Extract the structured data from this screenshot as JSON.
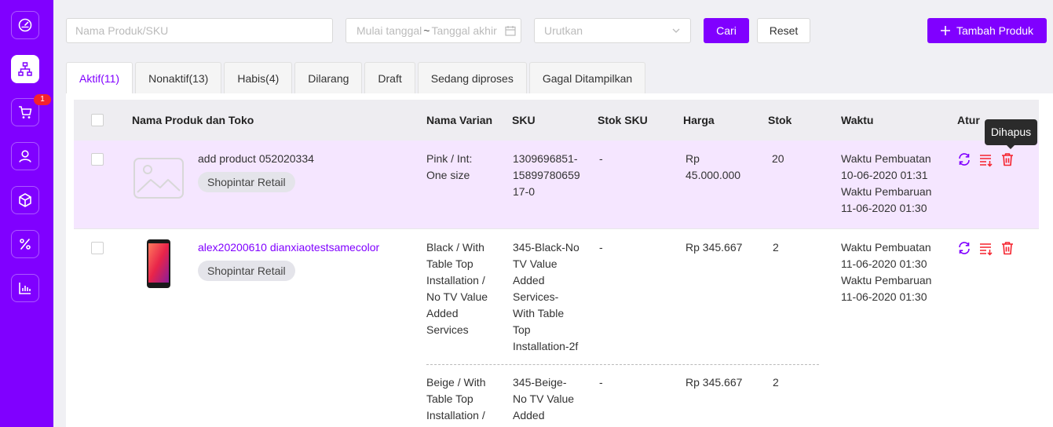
{
  "sidebar": {
    "items": [
      {
        "icon": "dashboard-icon",
        "active": false
      },
      {
        "icon": "sitemap-icon",
        "active": true
      },
      {
        "icon": "cart-icon",
        "active": false,
        "badge": "1"
      },
      {
        "icon": "user-icon",
        "active": false
      },
      {
        "icon": "box-icon",
        "active": false
      },
      {
        "icon": "percent-icon",
        "active": false
      },
      {
        "icon": "bar-chart-icon",
        "active": false
      }
    ]
  },
  "toolbar": {
    "search_placeholder": "Nama Produk/SKU",
    "date_start_placeholder": "Mulai tanggal",
    "date_separator": "~",
    "date_end_placeholder": "Tanggal akhir",
    "sort_placeholder": "Urutkan",
    "search_button": "Cari",
    "reset_button": "Reset",
    "add_button": "Tambah Produk"
  },
  "tabs": [
    {
      "label": "Aktif(11)",
      "active": true
    },
    {
      "label": "Nonaktif(13)",
      "active": false
    },
    {
      "label": "Habis(4)",
      "active": false
    },
    {
      "label": "Dilarang",
      "active": false
    },
    {
      "label": "Draft",
      "active": false
    },
    {
      "label": "Sedang diproses",
      "active": false
    },
    {
      "label": "Gagal Ditampilkan",
      "active": false
    }
  ],
  "table": {
    "headers": {
      "product": "Nama Produk dan Toko",
      "variant": "Nama Varian",
      "sku": "SKU",
      "sku_stock": "Stok SKU",
      "price": "Harga",
      "stock": "Stok",
      "time": "Waktu",
      "actions": "Atur"
    },
    "rows": [
      {
        "name": "add product 052020334",
        "store": "Shopintar Retail",
        "variants": [
          {
            "variant": "Pink / Int:\nOne size",
            "sku": "1309696851-\n15899780659\n17-0",
            "sku_stock": "-",
            "price": "Rp\n45.000.000",
            "stock": "20"
          }
        ],
        "created_label": "Waktu Pembuatan",
        "created": "10-06-2020 01:31",
        "updated_label": "Waktu Pembaruan",
        "updated": "11-06-2020 01:30"
      },
      {
        "name": "alex20200610 dianxiaotestsamecolor",
        "store": "Shopintar Retail",
        "variants": [
          {
            "variant": "Black / With\nTable Top\nInstallation /\nNo TV Value\nAdded\nServices",
            "sku": "345-Black-No\nTV Value\nAdded\nServices-\nWith Table\nTop\nInstallation-2f",
            "sku_stock": "-",
            "price": "Rp 345.667",
            "stock": "2"
          },
          {
            "variant": "Beige / With\nTable Top\nInstallation /",
            "sku": "345-Beige-\nNo TV Value\nAdded",
            "sku_stock": "-",
            "price": "Rp 345.667",
            "stock": "2"
          }
        ],
        "created_label": "Waktu Pembuatan",
        "created": "11-06-2020 01:30",
        "updated_label": "Waktu Pembaruan",
        "updated": "11-06-2020 01:30"
      }
    ]
  },
  "tooltip": "Dihapus",
  "colors": {
    "brand": "#8000ff",
    "row_highlight": "#f5e6ff",
    "delete": "#f5222d"
  }
}
